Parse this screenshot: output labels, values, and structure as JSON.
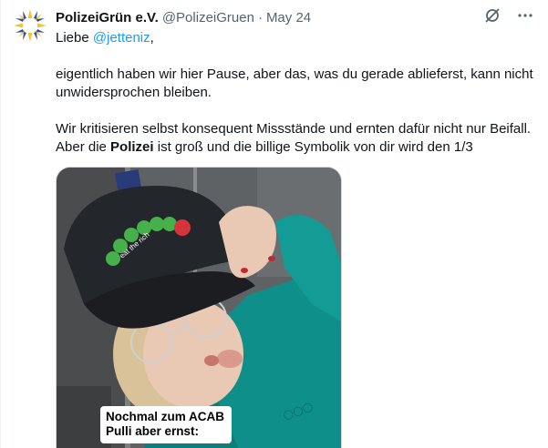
{
  "tweet": {
    "display_name": "PolizeiGrün e.V.",
    "handle": "@PolizeiGruen",
    "separator": "·",
    "date": "May 24",
    "greeting_prefix": "Liebe ",
    "mention": "@jetteniz",
    "greeting_suffix": ",",
    "para1": "eigentlich haben wir hier Pause, aber das, was du gerade ablieferst, kann nicht unwidersprochen bleiben.",
    "para2_start": "Wir kritisieren selbst konsequent Missstände und ernten dafür nicht nur Beifall. Aber die ",
    "para2_bold": "Polizei",
    "para2_end": " ist groß und die billige Symbolik von dir wird den 1/3"
  },
  "media": {
    "caption_line1": "Nochmal zum ACAB",
    "caption_line2": "Pulli aber ernst:",
    "cap_print": "eat the rich"
  },
  "icons": {
    "grok": "grok-icon",
    "more": "more-icon"
  },
  "colors": {
    "mention": "#1d9bf0",
    "secondary_text": "#536471",
    "sweater": "#0f8f8a",
    "cap": "#23262b",
    "avatar_star": "#f4c430",
    "avatar_blue": "#2e4aa6"
  }
}
